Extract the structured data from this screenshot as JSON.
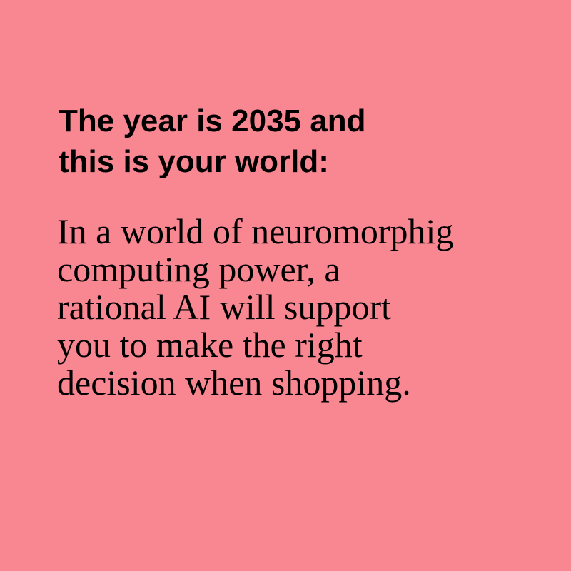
{
  "colors": {
    "background": "#f98792",
    "text": "#000000"
  },
  "heading": {
    "lines": [
      "The year is 2035 and",
      "this is your world:"
    ]
  },
  "body": {
    "lines": [
      "In a world of neuromorphig",
      "computing power, a",
      "rational AI will support",
      "you to make the right",
      "decision when shopping."
    ]
  }
}
